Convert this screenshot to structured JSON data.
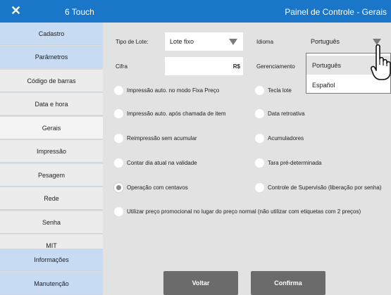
{
  "header": {
    "close_label": "✕",
    "app_title": "6 Touch",
    "panel_title": "Painel de Controle - Gerais",
    "bar_color": "#1a76c8"
  },
  "sidebar": {
    "items": [
      {
        "label": "Cadastro"
      },
      {
        "label": "Parâmetros"
      },
      {
        "label": "Código de barras"
      },
      {
        "label": "Data e hora"
      },
      {
        "label": "Gerais"
      },
      {
        "label": "Impressão"
      },
      {
        "label": "Pesagem"
      },
      {
        "label": "Rede"
      },
      {
        "label": "Senha"
      },
      {
        "label": "MIT"
      },
      {
        "label": "Informações"
      },
      {
        "label": "Manutenção"
      }
    ],
    "active": "Gerais"
  },
  "form": {
    "tipo_lote_label": "Tipo de Lote:",
    "tipo_lote_value": "Lote fixo",
    "idioma_label": "Idioma",
    "idioma_value": "Português",
    "cifra_label": "Cifra",
    "cifra_value": "R$",
    "gerenciamento_label": "Gerenciamento"
  },
  "options": {
    "impressao_fixa": {
      "label": "Impressão auto. no modo Fixa Preço",
      "checked": false
    },
    "tecla_lote": {
      "label": "Tecla lote",
      "checked": false
    },
    "impressao_chamada": {
      "label": "Impressão auto. após chamada de item",
      "checked": false
    },
    "data_retroativa": {
      "label": "Data retroativa",
      "checked": false
    },
    "reimpressao": {
      "label": "Reimpressão sem acumular",
      "checked": false
    },
    "acumuladores": {
      "label": "Acumuladores",
      "checked": false
    },
    "contar_dia": {
      "label": "Contar dia atual na validade",
      "checked": false
    },
    "tara": {
      "label": "Tara pré-determinada",
      "checked": false
    },
    "centavos": {
      "label": "Operação com centavos",
      "checked": true
    },
    "supervisao": {
      "label": "Controle de Supervisão (liberação por senha)",
      "checked": false
    },
    "promocional": {
      "label": "Utilizar preço promocional no lugar do preço normal (não utilizar com etiquetas com 2 preços)",
      "checked": false
    }
  },
  "language_dropdown": {
    "options": [
      "Português",
      "Español"
    ],
    "selected": "Português"
  },
  "footer": {
    "back_label": "Voltar",
    "confirm_label": "Confirma"
  }
}
